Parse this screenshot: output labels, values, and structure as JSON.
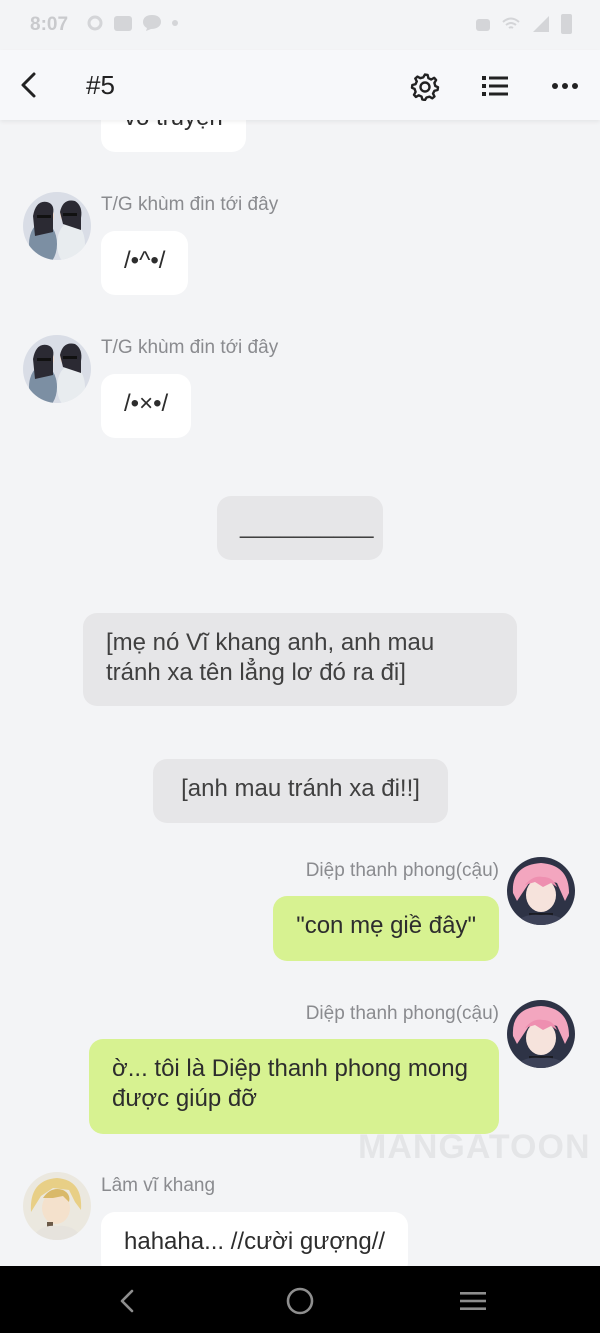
{
  "status_bar": {
    "time": "8:07"
  },
  "header": {
    "title": "#5"
  },
  "colors": {
    "background": "#f3f4f6",
    "bubble_white": "#ffffff",
    "bubble_gray": "#e6e6e8",
    "bubble_green": "#d7f291",
    "sender_text": "#8a8b8f"
  },
  "icons": {
    "back": "chevron-left-icon",
    "settings": "gear-icon",
    "chapters": "list-icon",
    "more": "ellipsis-icon"
  },
  "messages": [
    {
      "type": "incoming",
      "text": "vô truyện"
    },
    {
      "type": "incoming",
      "sender": "T/G khùm đin tới đây",
      "text": "/•^•/"
    },
    {
      "type": "incoming",
      "sender": "T/G khùm đin tới đây",
      "text": "/•×•/"
    },
    {
      "type": "narration",
      "text": "__________"
    },
    {
      "type": "narration",
      "text": "[mẹ nó Vĩ khang anh, anh mau tránh xa tên lẳng lơ đó ra đi]"
    },
    {
      "type": "narration",
      "text": "[anh mau tránh xa đi!!]"
    },
    {
      "type": "outgoing",
      "sender": "Diệp thanh phong(cậu)",
      "text": "\"con mẹ giề đây\""
    },
    {
      "type": "outgoing",
      "sender": "Diệp thanh phong(cậu)",
      "text": "ờ... tôi là Diệp thanh phong mong được giúp đỡ"
    },
    {
      "type": "incoming",
      "sender": "Lâm vĩ khang",
      "text": "hahaha... //cười gượng//"
    }
  ],
  "watermark": "MANGATOON"
}
